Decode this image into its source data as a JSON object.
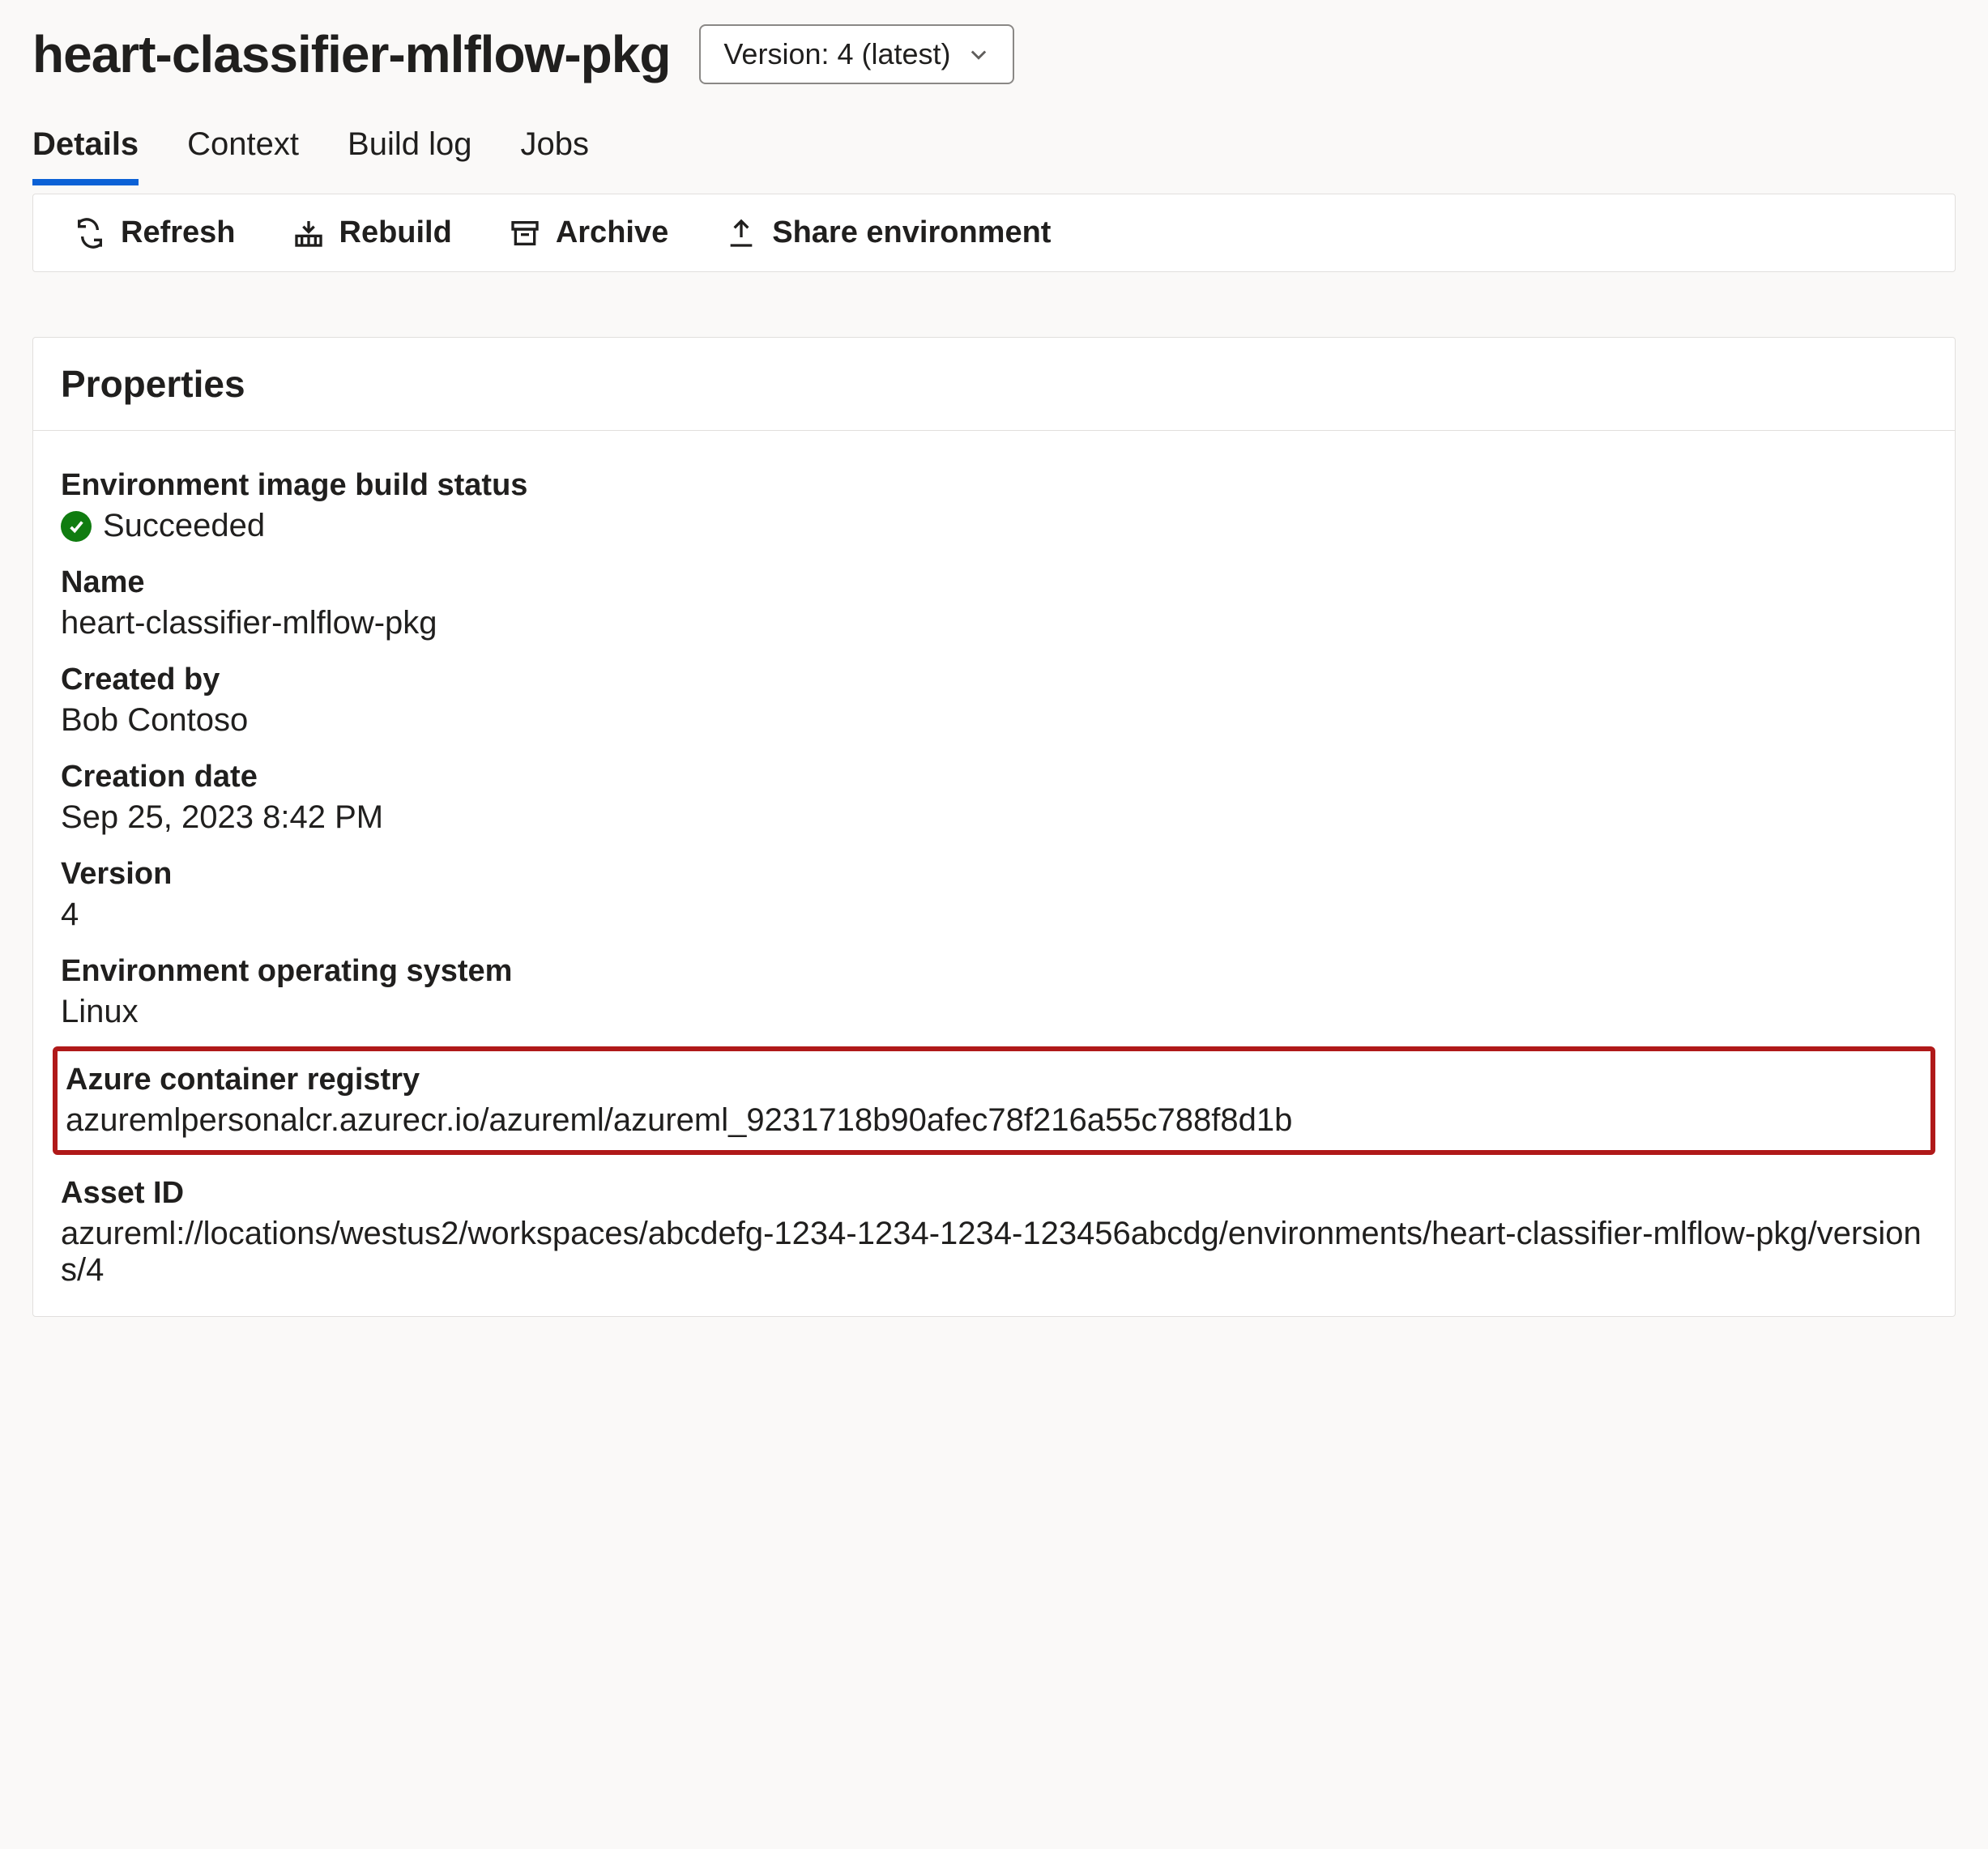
{
  "header": {
    "title": "heart-classifier-mlflow-pkg",
    "version_select_label": "Version: 4 (latest)"
  },
  "tabs": [
    {
      "label": "Details",
      "active": true
    },
    {
      "label": "Context",
      "active": false
    },
    {
      "label": "Build log",
      "active": false
    },
    {
      "label": "Jobs",
      "active": false
    }
  ],
  "toolbar": {
    "refresh": "Refresh",
    "rebuild": "Rebuild",
    "archive": "Archive",
    "share": "Share environment"
  },
  "panel": {
    "title": "Properties",
    "props": {
      "build_status_label": "Environment image build status",
      "build_status_value": "Succeeded",
      "name_label": "Name",
      "name_value": "heart-classifier-mlflow-pkg",
      "created_by_label": "Created by",
      "created_by_value": "Bob Contoso",
      "creation_date_label": "Creation date",
      "creation_date_value": "Sep 25, 2023 8:42 PM",
      "version_label": "Version",
      "version_value": "4",
      "os_label": "Environment operating system",
      "os_value": "Linux",
      "acr_label": "Azure container registry",
      "acr_value": "azuremlpersonalcr.azurecr.io/azureml/azureml_9231718b90afec78f216a55c788f8d1b",
      "asset_id_label": "Asset ID",
      "asset_id_value": "azureml://locations/westus2/workspaces/abcdefg-1234-1234-1234-123456abcdg/environments/heart-classifier-mlflow-pkg/versions/4"
    }
  }
}
